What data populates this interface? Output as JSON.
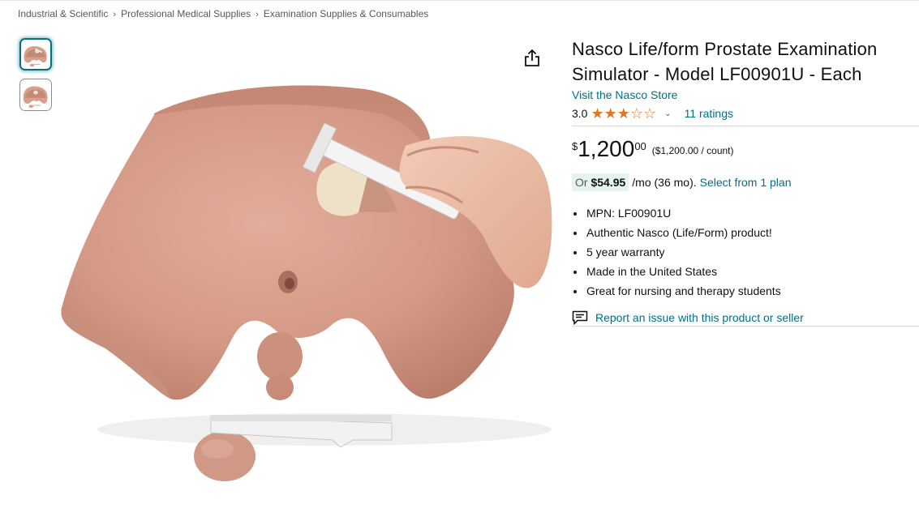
{
  "breadcrumb": {
    "items": [
      "Industrial & Scientific",
      "Professional Medical Supplies",
      "Examination Supplies & Consumables"
    ],
    "separator": "›"
  },
  "thumbnails": [
    {
      "icon": "product-thumbnail-1",
      "selected": true
    },
    {
      "icon": "product-thumbnail-2",
      "selected": false
    }
  ],
  "product": {
    "title": "Nasco Life/form Prostate Examination Simulator - Model LF00901U - Each",
    "store_link": "Visit the Nasco Store",
    "rating_value": "3.0",
    "rating_stars": 3,
    "rating_max": 5,
    "ratings_count": "11 ratings"
  },
  "price": {
    "symbol": "$",
    "whole": "1,200",
    "fraction": "00",
    "unit": "($1,200.00 / count)"
  },
  "installment": {
    "prefix": "Or",
    "amount": "$54.95",
    "term": "/mo (36 mo).",
    "plan_link": "Select from 1 plan"
  },
  "bullets": [
    "MPN: LF00901U",
    "Authentic Nasco (Life/Form) product!",
    "5 year warranty",
    "Made in the United States",
    "Great for nursing and therapy students"
  ],
  "report_link": "Report an issue with this product or seller",
  "colors": {
    "link": "#007185",
    "star": "#de7921",
    "installment_bg": "#e6f4f1"
  },
  "icons": {
    "share": "share-icon",
    "report": "report-icon",
    "chevron": "chevron-down-icon"
  }
}
